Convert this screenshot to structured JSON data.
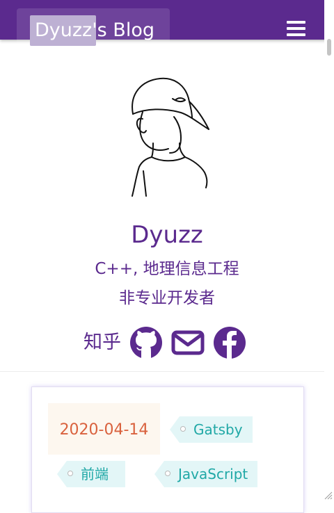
{
  "header": {
    "brand_highlight": "Dyuzz",
    "brand_title": "Dyuzz's Blog",
    "menu_icon": "hamburger-menu-icon"
  },
  "profile": {
    "avatar": "avatar-illustration",
    "name": "Dyuzz",
    "bio_line1": "C++, 地理信息工程",
    "bio_line2": "非专业开发者",
    "social": {
      "zhihu_label": "知乎",
      "icons": [
        "github-icon",
        "mail-icon",
        "facebook-icon"
      ]
    }
  },
  "post": {
    "date": "2020-04-14",
    "tags": [
      "Gatsby",
      "前端",
      "JavaScript"
    ]
  },
  "colors": {
    "primary": "#5b2a8e",
    "date_text": "#d9613d",
    "date_bg": "#fdf7ef",
    "tag_text": "#20a8a6",
    "tag_bg": "#e3f6f7"
  }
}
